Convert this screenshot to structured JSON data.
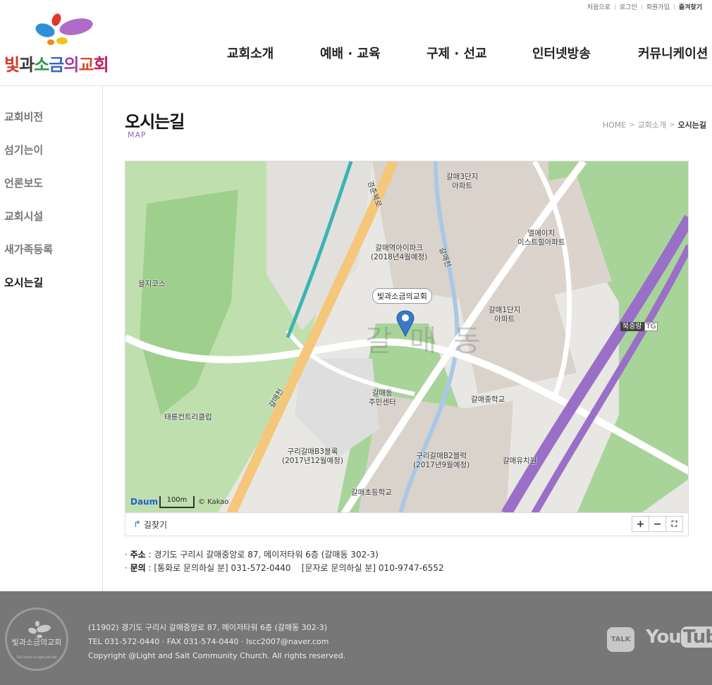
{
  "util": {
    "home": "처음으로",
    "login": "로그인",
    "join": "회원가입",
    "favorite": "즐겨찾기"
  },
  "logo": {
    "chars": [
      "빛",
      "과",
      "소",
      "금",
      "의",
      "교",
      "회"
    ],
    "colors": [
      "#d23a2b",
      "#3a3a3a",
      "#2a9a4a",
      "#3366cc",
      "#a040a0",
      "#d2502b",
      "#c02060"
    ]
  },
  "nav": [
    "교회소개",
    "예배 · 교육",
    "구제 · 선교",
    "인터넷방송",
    "커뮤니케이션"
  ],
  "sidebar": {
    "items": [
      {
        "label": "교회비전",
        "active": false
      },
      {
        "label": "섬기는이",
        "active": false
      },
      {
        "label": "언론보도",
        "active": false
      },
      {
        "label": "교회시설",
        "active": false
      },
      {
        "label": "새가족등록",
        "active": false
      },
      {
        "label": "오시는길",
        "active": true
      }
    ]
  },
  "content": {
    "title": "오시는길",
    "subtitle": "MAP",
    "breadcrumb": [
      "HOME",
      "교회소개",
      "오시는길"
    ]
  },
  "map": {
    "callout": "빛과소금의교회",
    "labels": {
      "apt3": "갈매3단지\n아파트",
      "aipark": "갈매역아이파크\n(2018년4월예정)",
      "east": "엘에이치\n이스트힐아파트",
      "apt1": "갈매1단지\n아파트",
      "course": "을지코스",
      "country": "태릉컨트리클럽",
      "center": "갈매동\n주민센터",
      "middle": "갈매중학교",
      "b3": "구리갈매B3블록\n(2017년12월예정)",
      "b2": "구리갈매B2블럭\n(2017년9월예정)",
      "kinder": "갈매유치원",
      "elem": "갈매초등학교",
      "area": "갈매동",
      "stream1": "갈매천",
      "stream2": "갈매천",
      "road": "경춘북로"
    },
    "tg_name": "북중랑",
    "tg_tag": "TG",
    "logo": "Daum",
    "scale": "100m",
    "copyright": "© Kakao",
    "route_label": "길찾기",
    "zoom_in": "+",
    "zoom_out": "−",
    "fullscreen": "⛶",
    "colors": {
      "ground": "#e8e7e3",
      "green": "#a8d49a",
      "block": "#d9d3cb",
      "road": "#ffffff",
      "highway": "#f4c77a",
      "expressway": "#9a6fc8",
      "rail": "#3bb3b3",
      "water": "#a9c8e8"
    }
  },
  "info": {
    "addr_label": "주소",
    "addr": "경기도 구리시 갈매중앙로 87, 메이저타워 6층 (갈매동 302-3)",
    "contact_label": "문의",
    "contact": "[통화로 문의하실 분] 031-572-0440    [문자로 문의하실 분] 010-9747-6552"
  },
  "footer": {
    "logo_text": "빛과소금의교회",
    "logo_sub": "The Church of Light and Salt",
    "line1": "(11902) 경기도 구리시 갈매중앙로 87, 메이저타워 6층 (갈매동 302-3)",
    "line2": "TEL 031-572-0440 · FAX 031-574-0440 · lscc2007@naver.com",
    "line3": "Copyright @Light and Salt Community Church. All rights reserved.",
    "talk": "TALK",
    "youtube_you": "You",
    "youtube_tube": "Tube"
  }
}
